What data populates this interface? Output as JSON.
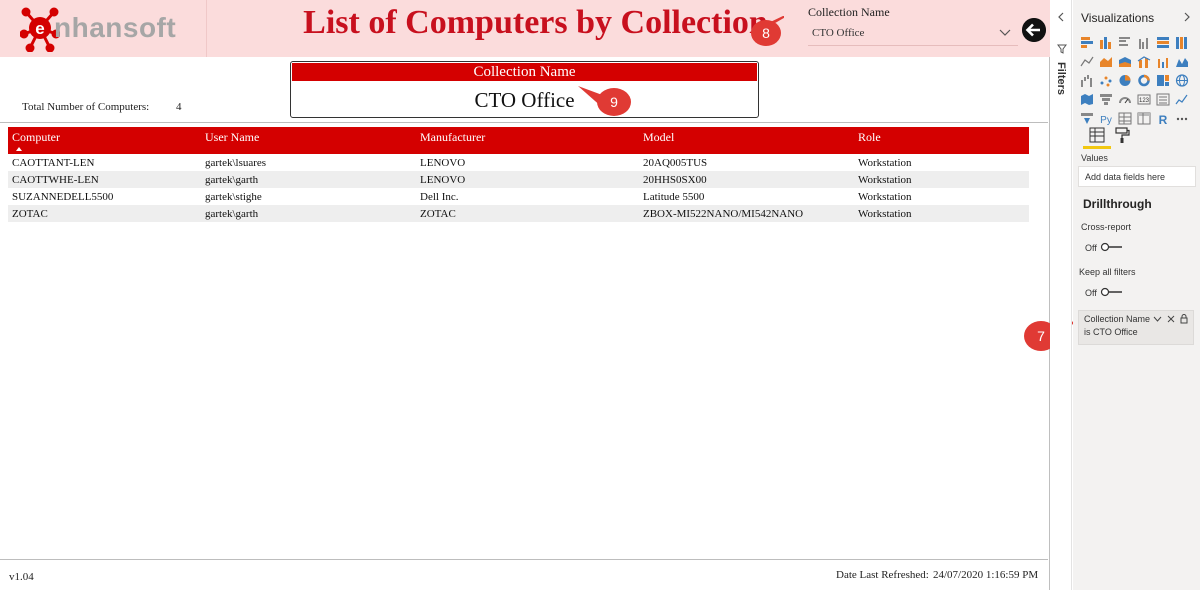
{
  "brand": {
    "logo_text": "nhansoft"
  },
  "report": {
    "title": "List of Computers by Collection",
    "slicer": {
      "label": "Collection Name",
      "value": "CTO Office"
    },
    "card": {
      "header": "Collection Name",
      "value": "CTO Office"
    },
    "total": {
      "label": "Total Number of Computers:",
      "value": "4"
    },
    "table": {
      "columns": [
        "Computer",
        "User Name",
        "Manufacturer",
        "Model",
        "Role"
      ],
      "rows": [
        [
          "CAOTTANT-LEN",
          "gartek\\lsuares",
          "LENOVO",
          "20AQ005TUS",
          "Workstation"
        ],
        [
          "CAOTTWHE-LEN",
          "gartek\\garth",
          "LENOVO",
          "20HHS0SX00",
          "Workstation"
        ],
        [
          "SUZANNEDELL5500",
          "gartek\\stighe",
          "Dell Inc.",
          "Latitude 5500",
          "Workstation"
        ],
        [
          "ZOTAC",
          "gartek\\garth",
          "ZOTAC",
          "ZBOX-MI522NANO/MI542NANO",
          "Workstation"
        ]
      ]
    },
    "footer": {
      "version": "v1.04",
      "refresh_label": "Date Last Refreshed:",
      "refresh_value": "24/07/2020 1:16:59 PM"
    }
  },
  "callouts": {
    "c7": "7",
    "c8": "8",
    "c9": "9"
  },
  "filters_pane": {
    "label": "Filters"
  },
  "viz_pane": {
    "title": "Visualizations",
    "values_label": "Values",
    "values_placeholder": "Add data fields here",
    "drillthrough_title": "Drillthrough",
    "cross_report_label": "Cross-report",
    "cross_report_state": "Off",
    "keep_filters_label": "Keep all filters",
    "keep_filters_state": "Off",
    "filter_card": {
      "field": "Collection Name",
      "condition": "is CTO Office"
    }
  },
  "colors": {
    "accent": "#d40000",
    "header_bg": "#fbdcdc",
    "title": "#c8101e",
    "callout": "#e03a34"
  }
}
